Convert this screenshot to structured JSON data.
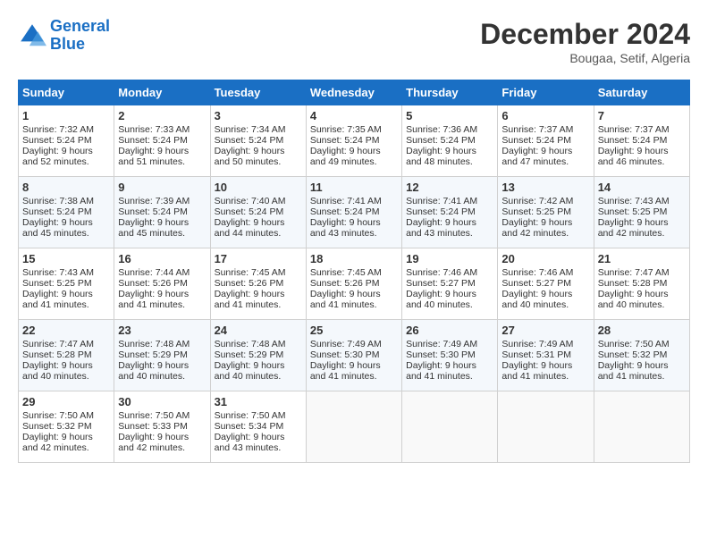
{
  "header": {
    "logo_line1": "General",
    "logo_line2": "Blue",
    "month": "December 2024",
    "location": "Bougaa, Setif, Algeria"
  },
  "days_of_week": [
    "Sunday",
    "Monday",
    "Tuesday",
    "Wednesday",
    "Thursday",
    "Friday",
    "Saturday"
  ],
  "weeks": [
    [
      {
        "day": "1",
        "sunrise": "7:32 AM",
        "sunset": "5:24 PM",
        "daylight": "9 hours and 52 minutes."
      },
      {
        "day": "2",
        "sunrise": "7:33 AM",
        "sunset": "5:24 PM",
        "daylight": "9 hours and 51 minutes."
      },
      {
        "day": "3",
        "sunrise": "7:34 AM",
        "sunset": "5:24 PM",
        "daylight": "9 hours and 50 minutes."
      },
      {
        "day": "4",
        "sunrise": "7:35 AM",
        "sunset": "5:24 PM",
        "daylight": "9 hours and 49 minutes."
      },
      {
        "day": "5",
        "sunrise": "7:36 AM",
        "sunset": "5:24 PM",
        "daylight": "9 hours and 48 minutes."
      },
      {
        "day": "6",
        "sunrise": "7:37 AM",
        "sunset": "5:24 PM",
        "daylight": "9 hours and 47 minutes."
      },
      {
        "day": "7",
        "sunrise": "7:37 AM",
        "sunset": "5:24 PM",
        "daylight": "9 hours and 46 minutes."
      }
    ],
    [
      {
        "day": "8",
        "sunrise": "7:38 AM",
        "sunset": "5:24 PM",
        "daylight": "9 hours and 45 minutes."
      },
      {
        "day": "9",
        "sunrise": "7:39 AM",
        "sunset": "5:24 PM",
        "daylight": "9 hours and 45 minutes."
      },
      {
        "day": "10",
        "sunrise": "7:40 AM",
        "sunset": "5:24 PM",
        "daylight": "9 hours and 44 minutes."
      },
      {
        "day": "11",
        "sunrise": "7:41 AM",
        "sunset": "5:24 PM",
        "daylight": "9 hours and 43 minutes."
      },
      {
        "day": "12",
        "sunrise": "7:41 AM",
        "sunset": "5:24 PM",
        "daylight": "9 hours and 43 minutes."
      },
      {
        "day": "13",
        "sunrise": "7:42 AM",
        "sunset": "5:25 PM",
        "daylight": "9 hours and 42 minutes."
      },
      {
        "day": "14",
        "sunrise": "7:43 AM",
        "sunset": "5:25 PM",
        "daylight": "9 hours and 42 minutes."
      }
    ],
    [
      {
        "day": "15",
        "sunrise": "7:43 AM",
        "sunset": "5:25 PM",
        "daylight": "9 hours and 41 minutes."
      },
      {
        "day": "16",
        "sunrise": "7:44 AM",
        "sunset": "5:26 PM",
        "daylight": "9 hours and 41 minutes."
      },
      {
        "day": "17",
        "sunrise": "7:45 AM",
        "sunset": "5:26 PM",
        "daylight": "9 hours and 41 minutes."
      },
      {
        "day": "18",
        "sunrise": "7:45 AM",
        "sunset": "5:26 PM",
        "daylight": "9 hours and 41 minutes."
      },
      {
        "day": "19",
        "sunrise": "7:46 AM",
        "sunset": "5:27 PM",
        "daylight": "9 hours and 40 minutes."
      },
      {
        "day": "20",
        "sunrise": "7:46 AM",
        "sunset": "5:27 PM",
        "daylight": "9 hours and 40 minutes."
      },
      {
        "day": "21",
        "sunrise": "7:47 AM",
        "sunset": "5:28 PM",
        "daylight": "9 hours and 40 minutes."
      }
    ],
    [
      {
        "day": "22",
        "sunrise": "7:47 AM",
        "sunset": "5:28 PM",
        "daylight": "9 hours and 40 minutes."
      },
      {
        "day": "23",
        "sunrise": "7:48 AM",
        "sunset": "5:29 PM",
        "daylight": "9 hours and 40 minutes."
      },
      {
        "day": "24",
        "sunrise": "7:48 AM",
        "sunset": "5:29 PM",
        "daylight": "9 hours and 40 minutes."
      },
      {
        "day": "25",
        "sunrise": "7:49 AM",
        "sunset": "5:30 PM",
        "daylight": "9 hours and 41 minutes."
      },
      {
        "day": "26",
        "sunrise": "7:49 AM",
        "sunset": "5:30 PM",
        "daylight": "9 hours and 41 minutes."
      },
      {
        "day": "27",
        "sunrise": "7:49 AM",
        "sunset": "5:31 PM",
        "daylight": "9 hours and 41 minutes."
      },
      {
        "day": "28",
        "sunrise": "7:50 AM",
        "sunset": "5:32 PM",
        "daylight": "9 hours and 41 minutes."
      }
    ],
    [
      {
        "day": "29",
        "sunrise": "7:50 AM",
        "sunset": "5:32 PM",
        "daylight": "9 hours and 42 minutes."
      },
      {
        "day": "30",
        "sunrise": "7:50 AM",
        "sunset": "5:33 PM",
        "daylight": "9 hours and 42 minutes."
      },
      {
        "day": "31",
        "sunrise": "7:50 AM",
        "sunset": "5:34 PM",
        "daylight": "9 hours and 43 minutes."
      },
      null,
      null,
      null,
      null
    ]
  ]
}
